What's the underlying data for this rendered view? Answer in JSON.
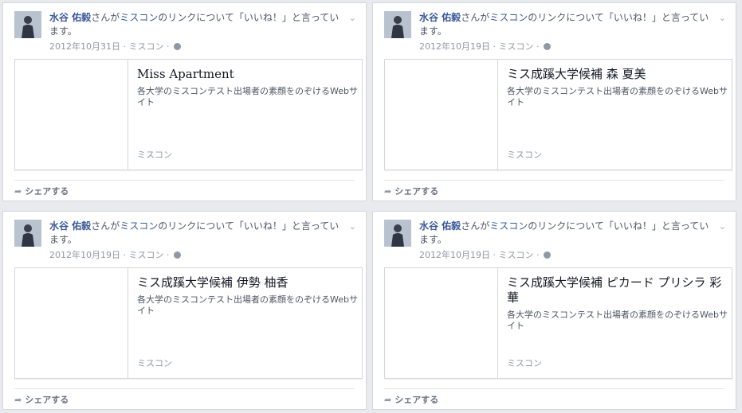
{
  "ui": {
    "chevron": "⌄",
    "sep": "·",
    "share_label": "シェアする"
  },
  "posts": [
    {
      "name": "水谷 佑毅",
      "story_mid": "さんが",
      "page": "ミスコン",
      "story_end": "のリンクについて「いいね！」と言っています。",
      "date": "2012年10月31日",
      "meta_page": "ミスコン",
      "title": "Miss Apartment",
      "desc": "各大学のミスコンテスト出場者の素顔をのぞけるWebサイト",
      "domain": "ミスコン"
    },
    {
      "name": "水谷 佑毅",
      "story_mid": "さんが",
      "page": "ミスコン",
      "story_end": "のリンクについて「いいね！」と言っています。",
      "date": "2012年10月19日",
      "meta_page": "ミスコン",
      "title": "ミス成蹊大学候補 森 夏美",
      "desc": "各大学のミスコンテスト出場者の素顔をのぞけるWebサイト",
      "domain": "ミスコン"
    },
    {
      "name": "水谷 佑毅",
      "story_mid": "さんが",
      "page": "ミスコン",
      "story_end": "のリンクについて「いいね！」と言っています。",
      "date": "2012年10月19日",
      "meta_page": "ミスコン",
      "title": "ミス成蹊大学候補 伊勢 柚香",
      "desc": "各大学のミスコンテスト出場者の素顔をのぞけるWebサイト",
      "domain": "ミスコン"
    },
    {
      "name": "水谷 佑毅",
      "story_mid": "さんが",
      "page": "ミスコン",
      "story_end": "のリンクについて「いいね！」と言っています。",
      "date": "2012年10月19日",
      "meta_page": "ミスコン",
      "title": "ミス成蹊大学候補 ピカード プリシラ 彩華",
      "desc": "各大学のミスコンテスト出場者の素顔をのぞけるWebサイト",
      "domain": "ミスコン"
    }
  ],
  "colors": {
    "link": "#3b5998",
    "background": "#e9eaed",
    "meta": "#9197a3"
  }
}
